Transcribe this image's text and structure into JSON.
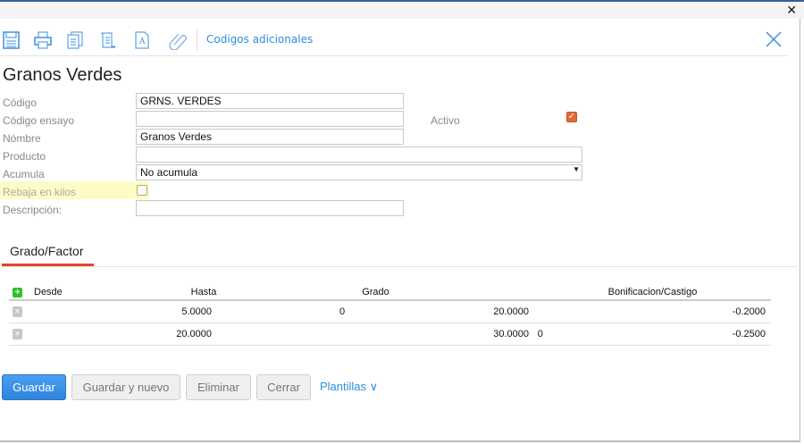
{
  "window": {
    "close_glyph": "✕"
  },
  "toolbar": {
    "link": "Codigos adicionales",
    "icons": [
      "save-icon",
      "print-icon",
      "copy-icon",
      "script-icon",
      "document-font-icon",
      "attachment-icon"
    ]
  },
  "title": "Granos Verdes",
  "form": {
    "codigo": {
      "label": "Código",
      "value": "GRNS. VERDES"
    },
    "codigo_ensayo": {
      "label": "Código ensayo",
      "value": ""
    },
    "activo": {
      "label": "Activo",
      "checked": true
    },
    "nombre": {
      "label": "Nómbre",
      "value": "Granos Verdes"
    },
    "producto": {
      "label": "Producto",
      "value": ""
    },
    "acumula": {
      "label": "Acumula",
      "value": "No acumula"
    },
    "rebaja": {
      "label": "Rebaja en kilos",
      "checked": false
    },
    "descripcion": {
      "label": "Descripción:",
      "value": ""
    }
  },
  "tab": "Grado/Factor",
  "table": {
    "headers": [
      "Desde",
      "Hasta",
      "Grado",
      "Bonificacion/Castigo"
    ],
    "rows": [
      [
        "5.0000",
        "20.0000",
        "0",
        "-0.2000"
      ],
      [
        "20.0000",
        "30.0000",
        "0",
        "-0.2500"
      ]
    ]
  },
  "buttons": {
    "guardar": "Guardar",
    "guardar_nuevo": "Guardar y nuevo",
    "eliminar": "Eliminar",
    "cerrar": "Cerrar",
    "plantillas": "Plantillas ∨"
  },
  "colors": {
    "accent": "#2b8ee8",
    "tab_underline": "#e8412b",
    "checkbox": "#e06a3a"
  }
}
